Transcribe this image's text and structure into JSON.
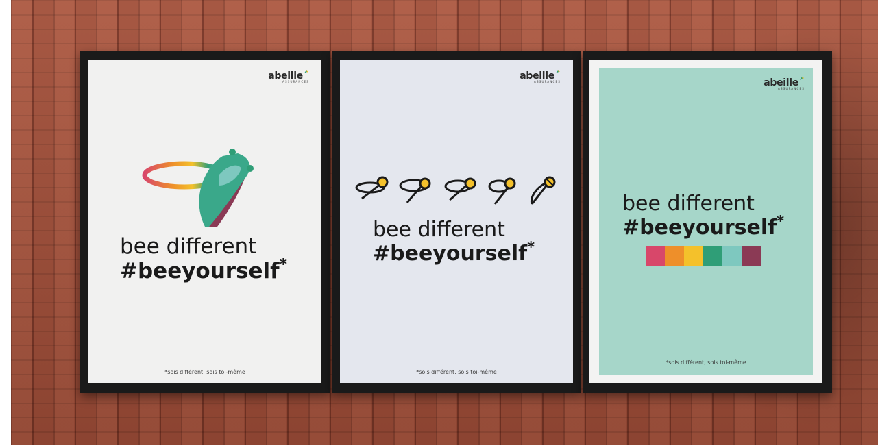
{
  "scene": {
    "brand": {
      "name": "abeille",
      "subtitle": "ASSURANCES"
    },
    "posters": [
      {
        "headline_light": "bee different",
        "headline_bold": "#beeyourself",
        "asterisk": "*",
        "footnote": "*sois différent, sois toi-même",
        "background": "#f1f1f0",
        "artwork": "ring-icon"
      },
      {
        "headline_light": "bee different",
        "headline_bold": "#beeyourself",
        "asterisk": "*",
        "footnote": "*sois différent, sois toi-même",
        "background": "#e4e7ee",
        "artwork": "bee-sequence-icon"
      },
      {
        "headline_light": "bee different",
        "headline_bold": "#beeyourself",
        "asterisk": "*",
        "footnote": "*sois différent, sois toi-même",
        "background": "#a6d6c9",
        "artwork": "color-swatches"
      }
    ],
    "palette": [
      "#d8476a",
      "#ee8f2a",
      "#f4c12b",
      "#2f9e77",
      "#7ec8bf",
      "#8b3a55"
    ]
  }
}
